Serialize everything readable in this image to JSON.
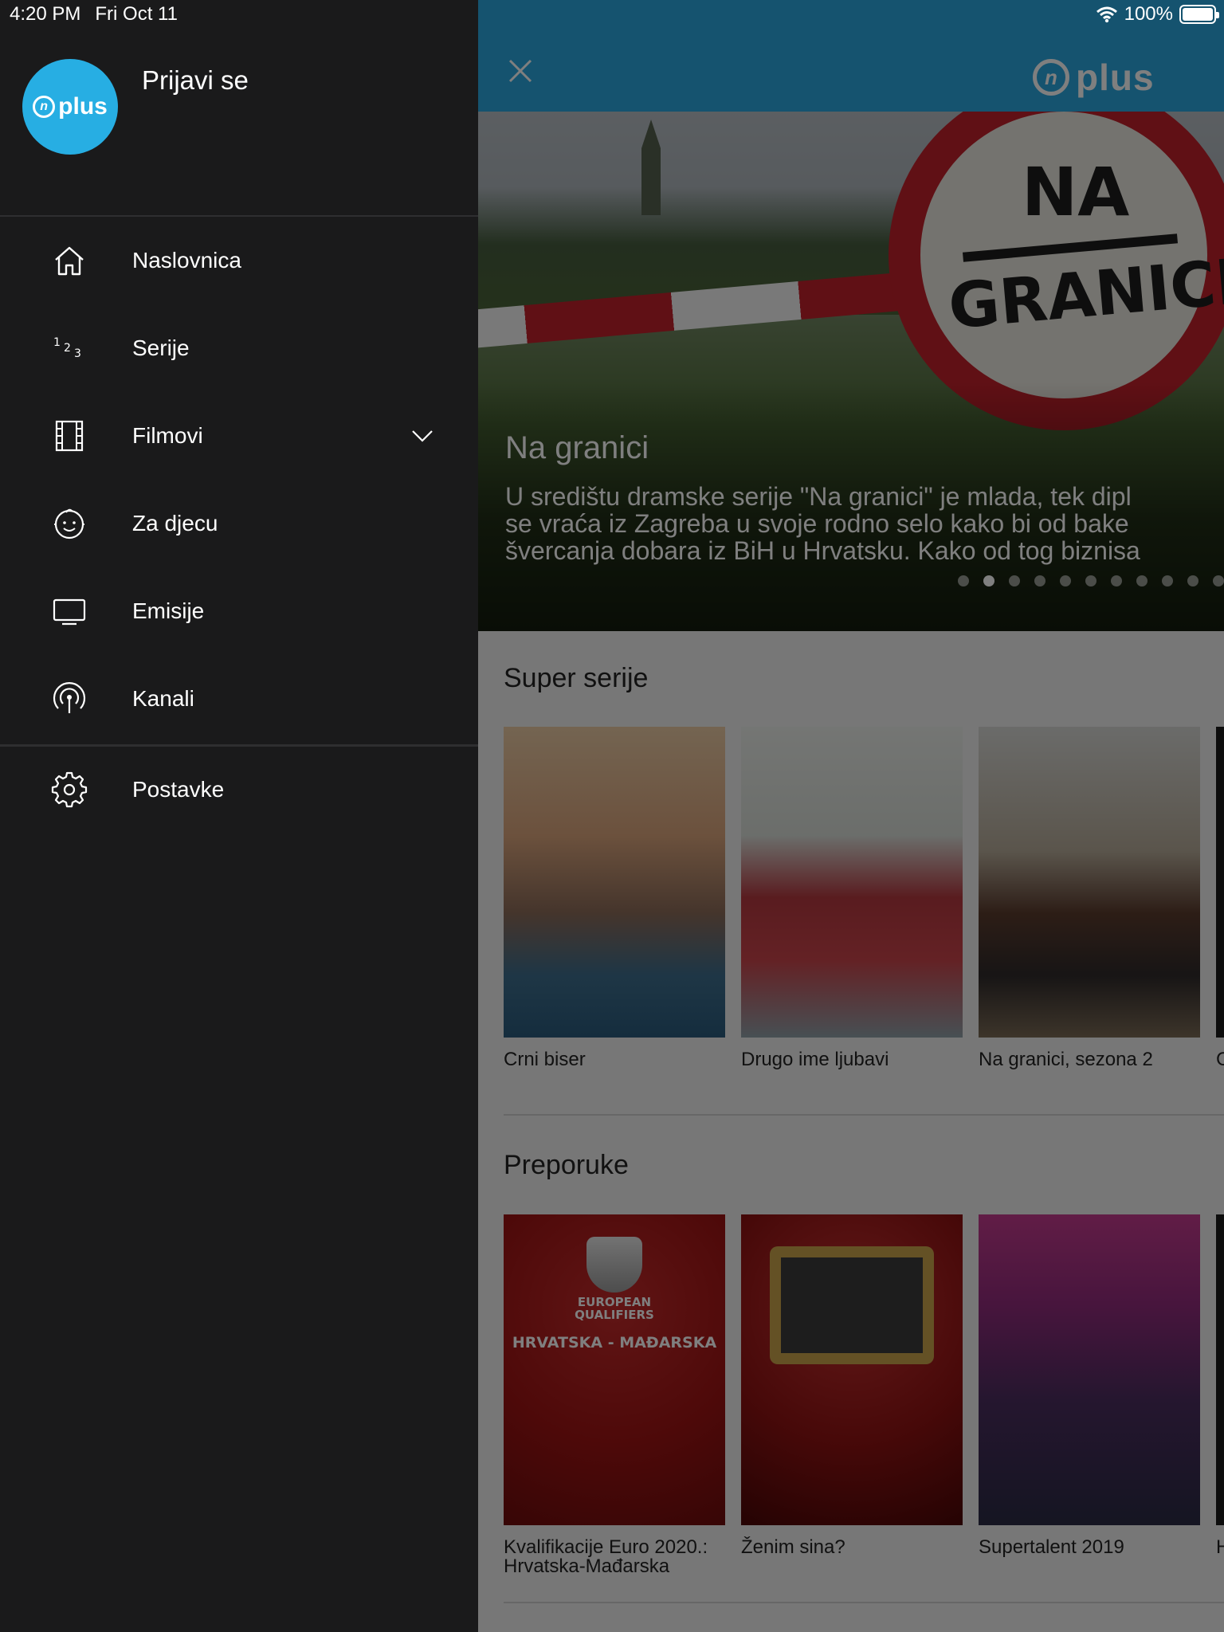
{
  "status_bar": {
    "time": "4:20 PM",
    "date": "Fri Oct 11",
    "battery": "100%"
  },
  "drawer": {
    "brand_logo": "plus",
    "login_label": "Prijavi se",
    "menu": [
      {
        "label": "Naslovnica",
        "icon": "home-icon"
      },
      {
        "label": "Serije",
        "icon": "numbers-icon"
      },
      {
        "label": "Filmovi",
        "icon": "film-icon",
        "expandable": true
      },
      {
        "label": "Za djecu",
        "icon": "baby-face-icon"
      },
      {
        "label": "Emisije",
        "icon": "tv-icon"
      },
      {
        "label": "Kanali",
        "icon": "broadcast-icon"
      }
    ],
    "settings_label": "Postavke",
    "settings_icon": "gear-icon"
  },
  "app": {
    "header_logo": "plus",
    "hero": {
      "sign_top": "NA",
      "sign_bottom": "GRANICI",
      "title": "Na granici",
      "description": "U središtu dramske serije \"Na granici\" je mlada, tek dipl\nse vraća iz Zagreba u svoje rodno selo kako bi od bake\nšvercanja dobara iz BiH u Hrvatsku. Kako od tog biznisa",
      "slide_count": 11,
      "active_slide": 2
    },
    "sections": [
      {
        "title": "Super serije",
        "items": [
          "Crni biser",
          "Drugo ime ljubavi",
          "Na granici, sezona 2",
          "C"
        ]
      },
      {
        "title": "Preporuke",
        "items": [
          "Kvalifikacije Euro 2020.:\nHrvatska-Mađarska",
          "Ženim sina?",
          "Supertalent 2019",
          "H"
        ],
        "poster_text": {
          "qualifiers": "EUROPEAN\nQUALIFIERS",
          "match": "HRVATSKA - MAĐARSKA"
        }
      }
    ]
  },
  "colors": {
    "accent": "#27aee3",
    "drawer_bg": "#1a1a1b",
    "header": "#2aa7de"
  }
}
